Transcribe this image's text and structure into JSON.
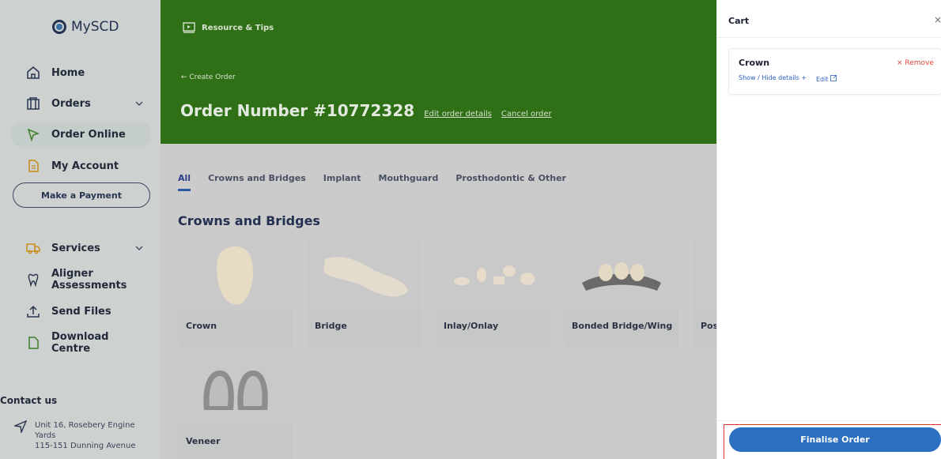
{
  "sidebar": {
    "logo": "MySCD",
    "items": [
      {
        "label": "Home",
        "icon": "home-icon"
      },
      {
        "label": "Orders",
        "icon": "orders-icon"
      },
      {
        "label": "Order Online",
        "icon": "cursor-icon"
      },
      {
        "label": "My Account",
        "icon": "document-icon"
      },
      {
        "label": "Services",
        "icon": "truck-icon"
      },
      {
        "label": "Aligner Assessments",
        "icon": "tooth-icon"
      },
      {
        "label": "Send Files",
        "icon": "upload-icon"
      },
      {
        "label": "Download Centre",
        "icon": "file-icon"
      }
    ],
    "make_payment": "Make a Payment",
    "contact_title": "Contact us",
    "contact_line1": "Unit 16, Rosebery Engine Yards",
    "contact_line2": "115-151 Dunning Avenue"
  },
  "header": {
    "resource": "Resource & Tips",
    "back": "← Create Order",
    "order_title": "Order Number #10772328",
    "edit_link": "Edit order details",
    "cancel_link": "Cancel order"
  },
  "tabs": [
    "All",
    "Crowns and Bridges",
    "Implant",
    "Mouthguard",
    "Prosthodontic & Other"
  ],
  "section_title": "Crowns and Bridges",
  "products": [
    "Crown",
    "Bridge",
    "Inlay/Onlay",
    "Bonded Bridge/Wing",
    "Pos",
    "Veneer"
  ],
  "cart": {
    "title": "Cart",
    "close": "×",
    "item_name": "Crown",
    "remove": "× Remove",
    "details": "Show / Hide details +",
    "edit": "Edit",
    "finalise": "Finalise Order"
  },
  "colors": {
    "banner": "#2f6f16",
    "accent": "#2a6fc0",
    "remove": "#e0463d",
    "highlight": "#e0332b"
  }
}
